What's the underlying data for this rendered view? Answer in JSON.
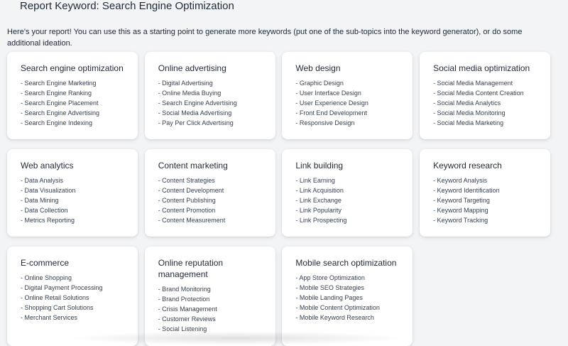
{
  "report": {
    "title": "Report Keyword: Search Engine Optimization",
    "intro": "Here's your report! You can use this as a starting point to generate more keywords (put one of the sub-topics into the keyword generator), or do some additional ideation."
  },
  "cards": [
    {
      "title": "Search engine optimization",
      "items": [
        "- Search Engine Marketing",
        "- Search Engine Ranking",
        "- Search Engine Placement",
        "- Search Engine Advertising",
        "- Search Engine Indexing"
      ]
    },
    {
      "title": "Online advertising",
      "items": [
        "- Digital Advertising",
        "- Online Media Buying",
        "- Search Engine Advertising",
        "- Social Media Advertising",
        "- Pay Per Click Advertising"
      ]
    },
    {
      "title": "Web design",
      "items": [
        "- Graphic Design",
        "- User Interface Design",
        "- User Experience Design",
        "- Front End Development",
        "- Responsive Design"
      ]
    },
    {
      "title": "Social media optimization",
      "items": [
        "- Social Media Management",
        "- Social Media Content Creation",
        "- Social Media Analytics",
        "- Social Media Monitoring",
        "- Social Media Marketing"
      ]
    },
    {
      "title": "Web analytics",
      "items": [
        "- Data Analysis",
        "- Data Visualization",
        "- Data Mining",
        "- Data Collection",
        "- Metrics Reporting"
      ]
    },
    {
      "title": "Content marketing",
      "items": [
        "- Content Strategies",
        "- Content Development",
        "- Content Publishing",
        "- Content Promotion",
        "- Content Measurement"
      ]
    },
    {
      "title": "Link building",
      "items": [
        "- Link Earning",
        "- Link Acquisition",
        "- Link Exchange",
        "- Link Popularity",
        "- Link Prospecting"
      ]
    },
    {
      "title": "Keyword research",
      "items": [
        "- Keyword Analysis",
        "- Keyword Identification",
        "- Keyword Targeting",
        "- Keyword Mapping",
        "- Keyword Tracking"
      ]
    },
    {
      "title": "E-commerce",
      "items": [
        "- Online Shopping",
        "- Digital Payment Processing",
        "- Online Retail Solutions",
        "- Shopping Cart Solutions",
        "- Merchant Services"
      ]
    },
    {
      "title": "Online reputation management",
      "items": [
        "- Brand Monitoring",
        "- Brand Protection",
        "- Crisis Management",
        "- Customer Reviews",
        "- Social Listening"
      ]
    },
    {
      "title": "Mobile search optimization",
      "items": [
        "- App Store Optimization",
        "- Mobile SEO Strategies",
        "- Mobile Landing Pages",
        "- Mobile Content Optimization",
        "- Mobile Keyword Research"
      ]
    }
  ]
}
